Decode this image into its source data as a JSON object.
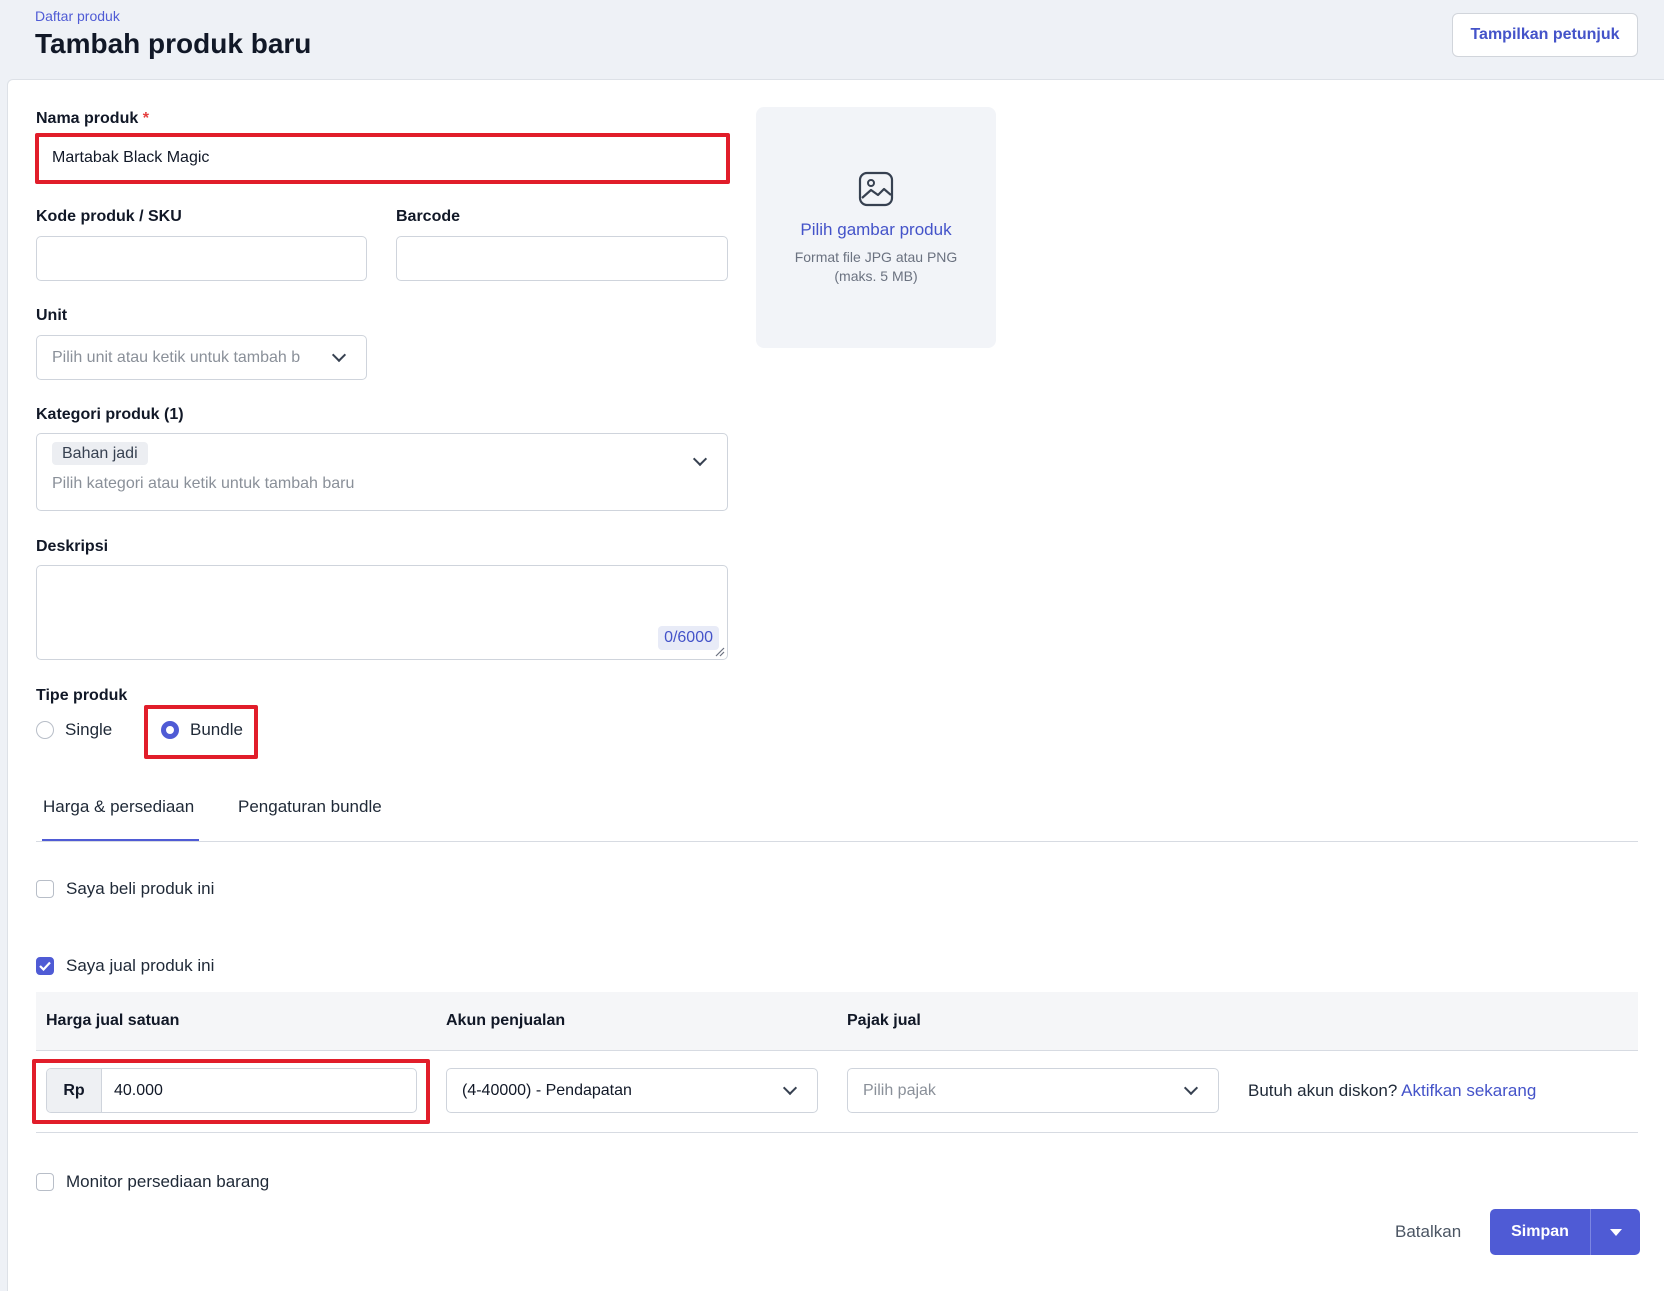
{
  "header": {
    "breadcrumb": "Daftar produk",
    "title": "Tambah produk baru",
    "help_button": "Tampilkan petunjuk"
  },
  "form": {
    "name": {
      "label": "Nama produk",
      "required_mark": "*",
      "value": "Martabak Black Magic"
    },
    "sku": {
      "label": "Kode produk / SKU",
      "value": ""
    },
    "barcode": {
      "label": "Barcode",
      "value": ""
    },
    "unit": {
      "label": "Unit",
      "placeholder": "Pilih unit atau ketik untuk tambah b"
    },
    "category": {
      "label": "Kategori produk (1)",
      "chip": "Bahan jadi",
      "placeholder": "Pilih kategori atau ketik untuk tambah baru"
    },
    "description": {
      "label": "Deskripsi",
      "counter": "0/6000"
    },
    "type": {
      "label": "Tipe produk",
      "options": [
        "Single",
        "Bundle"
      ],
      "selected": "Bundle"
    }
  },
  "upload": {
    "title": "Pilih gambar produk",
    "hint_line1": "Format file JPG atau PNG",
    "hint_line2": "(maks. 5 MB)",
    "icon": "image-icon"
  },
  "tabs": [
    {
      "label": "Harga & persediaan",
      "active": true
    },
    {
      "label": "Pengaturan bundle",
      "active": false
    }
  ],
  "purchase": {
    "label": "Saya beli produk ini",
    "checked": false
  },
  "sale": {
    "label": "Saya jual produk ini",
    "checked": true,
    "columns": [
      "Harga jual satuan",
      "Akun penjualan",
      "Pajak jual"
    ],
    "currency": "Rp",
    "price": "40.000",
    "account": "(4-40000) - Pendapatan",
    "tax_placeholder": "Pilih pajak",
    "discount_question": "Butuh akun diskon?",
    "discount_link": "Aktifkan sekarang"
  },
  "inventory": {
    "label": "Monitor persediaan barang",
    "checked": false
  },
  "actions": {
    "cancel": "Batalkan",
    "save": "Simpan"
  },
  "colors": {
    "accent": "#4f5bd5",
    "highlight": "#e11d2a"
  }
}
